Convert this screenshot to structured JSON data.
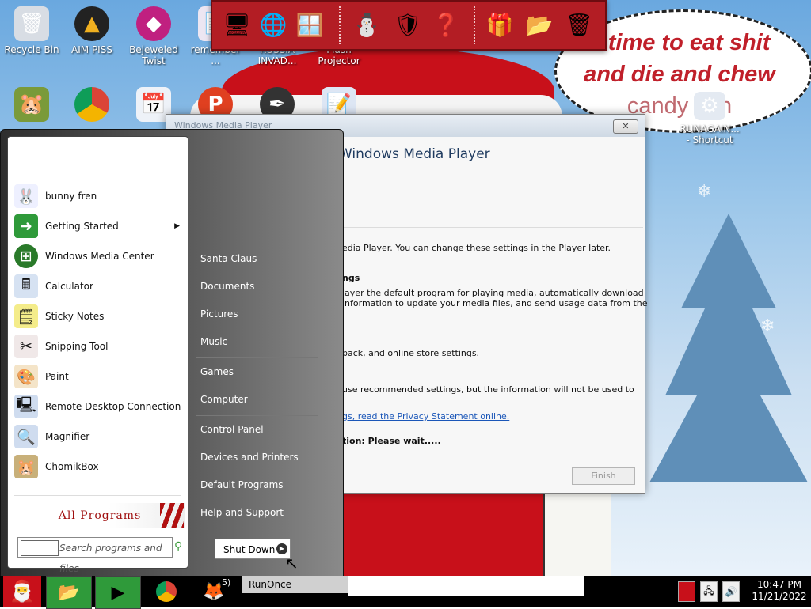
{
  "desktop": {
    "icons": [
      {
        "label": "Recycle Bin",
        "icon": "recycle-bin-icon"
      },
      {
        "label": "AIM PISS",
        "icon": "aim-icon"
      },
      {
        "label": "Bejeweled Twist",
        "icon": "bejeweled-icon"
      },
      {
        "label": "remember ...",
        "icon": "generic-icon"
      },
      {
        "label": "RUSSIA INVAD...",
        "icon": "globe-icon"
      },
      {
        "label": "Flash Projector",
        "icon": "flash-icon"
      },
      {
        "label": "RUNAGAIN... - Shortcut",
        "icon": "gear-icon"
      }
    ],
    "speech_bubble": {
      "line1": "...time to eat shit",
      "line2": "and die and chew",
      "line3": "candy can"
    }
  },
  "wmp": {
    "title": "Windows Media Player",
    "heading": "Windows Media Player",
    "line1": "edia Player. You can change these settings in the Player later.",
    "line2": "ngs",
    "line3": "layer the default program for playing media, automatically download",
    "line4": "information to update your media files, and send usage data from the",
    "line5": "back, and online store settings.",
    "line6": "use recommended settings, but the information will not be used to",
    "line7": "gs, read the Privacy Statement online.",
    "line8": "tion: Please wait.....",
    "finish": "Finish",
    "close": "✕"
  },
  "start_menu": {
    "programs": [
      {
        "label": "bunny fren",
        "icon": "bunny-icon",
        "color": "#ffffff"
      },
      {
        "label": "Getting Started",
        "icon": "getting-started-icon",
        "color": "#2f9a3a"
      },
      {
        "label": "Windows Media Center",
        "icon": "media-center-icon",
        "color": "#2a7a2a"
      },
      {
        "label": "Calculator",
        "icon": "calculator-icon",
        "color": "#5a7fb0"
      },
      {
        "label": "Sticky Notes",
        "icon": "sticky-notes-icon",
        "color": "#e8d84a"
      },
      {
        "label": "Snipping Tool",
        "icon": "scissors-icon",
        "color": "#d94040"
      },
      {
        "label": "Paint",
        "icon": "paint-palette-icon",
        "color": "#e0a040"
      },
      {
        "label": "Remote Desktop Connection",
        "icon": "remote-desktop-icon",
        "color": "#3a6fb0"
      },
      {
        "label": "Magnifier",
        "icon": "magnifier-icon",
        "color": "#3a6fb0"
      },
      {
        "label": "ChomikBox",
        "icon": "hamster-icon",
        "color": "#a07a3a"
      }
    ],
    "all_programs": "All Programs",
    "search_placeholder": "Search programs and files",
    "right_items": [
      "Santa Claus",
      "Documents",
      "Pictures",
      "Music",
      "Games",
      "Computer",
      "Control Panel",
      "Devices and Printers",
      "Default Programs",
      "Help and Support"
    ],
    "shutdown": "Shut Down"
  },
  "taskbar": {
    "runonce": "RunOnce",
    "badge": "5)",
    "clock_time": "10:47 PM",
    "clock_date": "11/21/2022"
  },
  "colors": {
    "accent_red": "#c8101a",
    "sky_blue": "#6aa8df"
  }
}
